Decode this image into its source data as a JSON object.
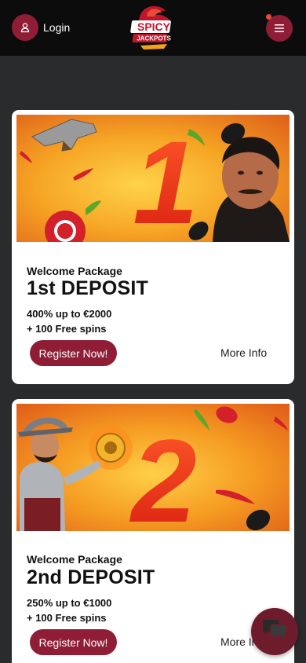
{
  "header": {
    "login_label": "Login",
    "logo_text_top": "SPICY",
    "logo_text_bottom": "JACKPOTS"
  },
  "promotions": [
    {
      "label": "Welcome Package",
      "title": "1st DEPOSIT",
      "offer_line1": "400% up to €2000",
      "offer_line2": "+ 100 Free spins",
      "register_label": "Register Now!",
      "more_info_label": "More Info",
      "banner_number": "1"
    },
    {
      "label": "Welcome Package",
      "title": "2nd DEPOSIT",
      "offer_line1": "250% up to €1000",
      "offer_line2": "+ 100 Free spins",
      "register_label": "Register Now!",
      "more_info_label": "More Info",
      "banner_number": "2"
    }
  ],
  "colors": {
    "brand": "#8e1d35",
    "header_bg": "#0c0c0c",
    "page_bg": "#2a2b2c",
    "notification": "#e8493a"
  },
  "icons": [
    "user-icon",
    "hamburger-icon",
    "chat-icon"
  ]
}
